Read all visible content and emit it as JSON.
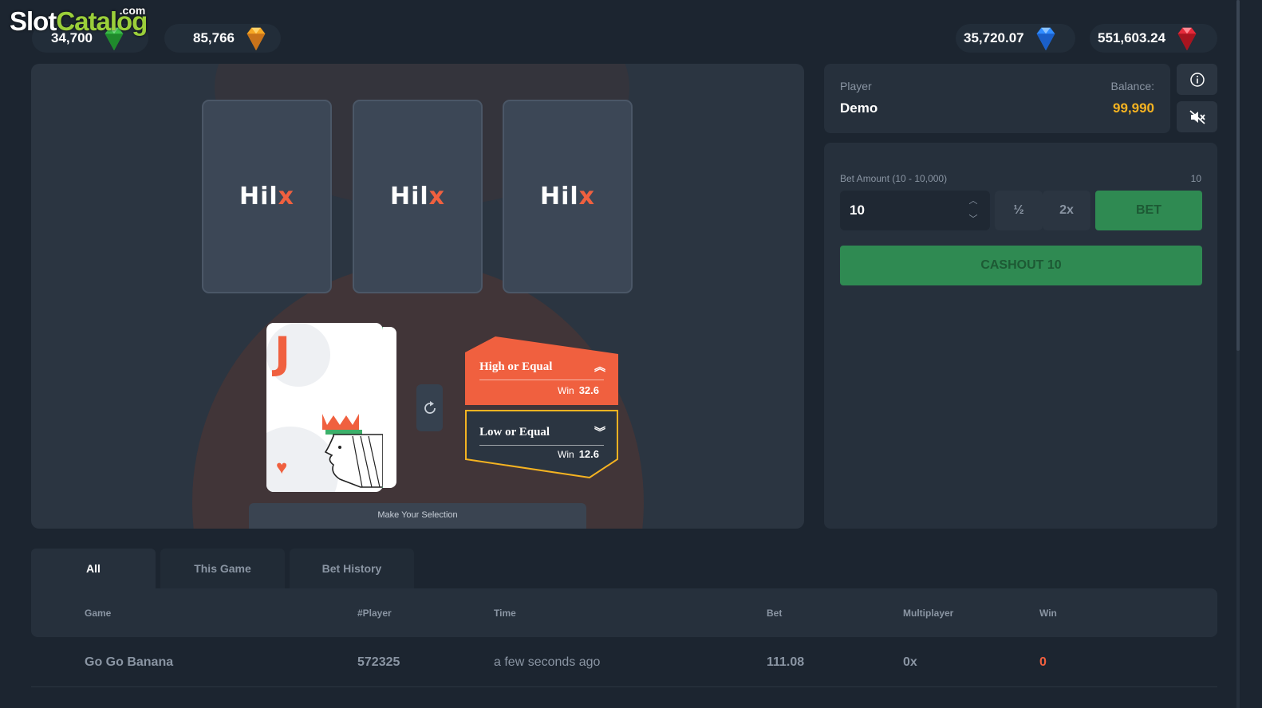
{
  "branding": {
    "logo_slot": "Slot",
    "logo_catalog": "Catalog",
    "logo_com": ".com"
  },
  "jackpots": {
    "green": {
      "value": "34,700",
      "icon": "green-gem-icon",
      "color": "#3cc24a"
    },
    "orange": {
      "value": "85,766",
      "icon": "orange-gem-icon",
      "color": "#f5a623"
    },
    "blue": {
      "value": "35,720.07",
      "icon": "blue-gem-icon",
      "color": "#2f8bff"
    },
    "red": {
      "value": "551,603.24",
      "icon": "red-gem-icon",
      "color": "#e52a3a"
    }
  },
  "game": {
    "deck_logo_main": "Hil",
    "deck_logo_accent": "x",
    "current_card": {
      "rank": "J",
      "suit": "♥"
    },
    "choices": {
      "high": {
        "label": "High or Equal",
        "win_label": "Win",
        "win_value": "32.6"
      },
      "low": {
        "label": "Low or Equal",
        "win_label": "Win",
        "win_value": "12.6"
      }
    },
    "status": "Make Your Selection"
  },
  "player": {
    "player_label": "Player",
    "player_name": "Demo",
    "balance_label": "Balance:",
    "balance_value": "99,990"
  },
  "bet": {
    "amount_label": "Bet Amount (10 - 10,000)",
    "current_display": "10",
    "input_value": "10",
    "half_label": "½",
    "double_label": "2x",
    "bet_label": "BET",
    "cashout_label": "CASHOUT 10"
  },
  "tabs": [
    {
      "label": "All",
      "active": true
    },
    {
      "label": "This Game",
      "active": false
    },
    {
      "label": "Bet History",
      "active": false
    }
  ],
  "table": {
    "headers": [
      "Game",
      "#Player",
      "Time",
      "Bet",
      "Multiplayer",
      "Win"
    ],
    "rows": [
      {
        "game": "Go Go Banana",
        "player": "572325",
        "time": "a few seconds ago",
        "bet": "111.08",
        "multiplier": "0x",
        "win": "0"
      }
    ]
  },
  "colors": {
    "background": "#1c2530",
    "panel": "#26303c",
    "accent_orange": "#f0603f",
    "balance_gold": "#f5b321",
    "bet_green": "#2f8a52"
  }
}
